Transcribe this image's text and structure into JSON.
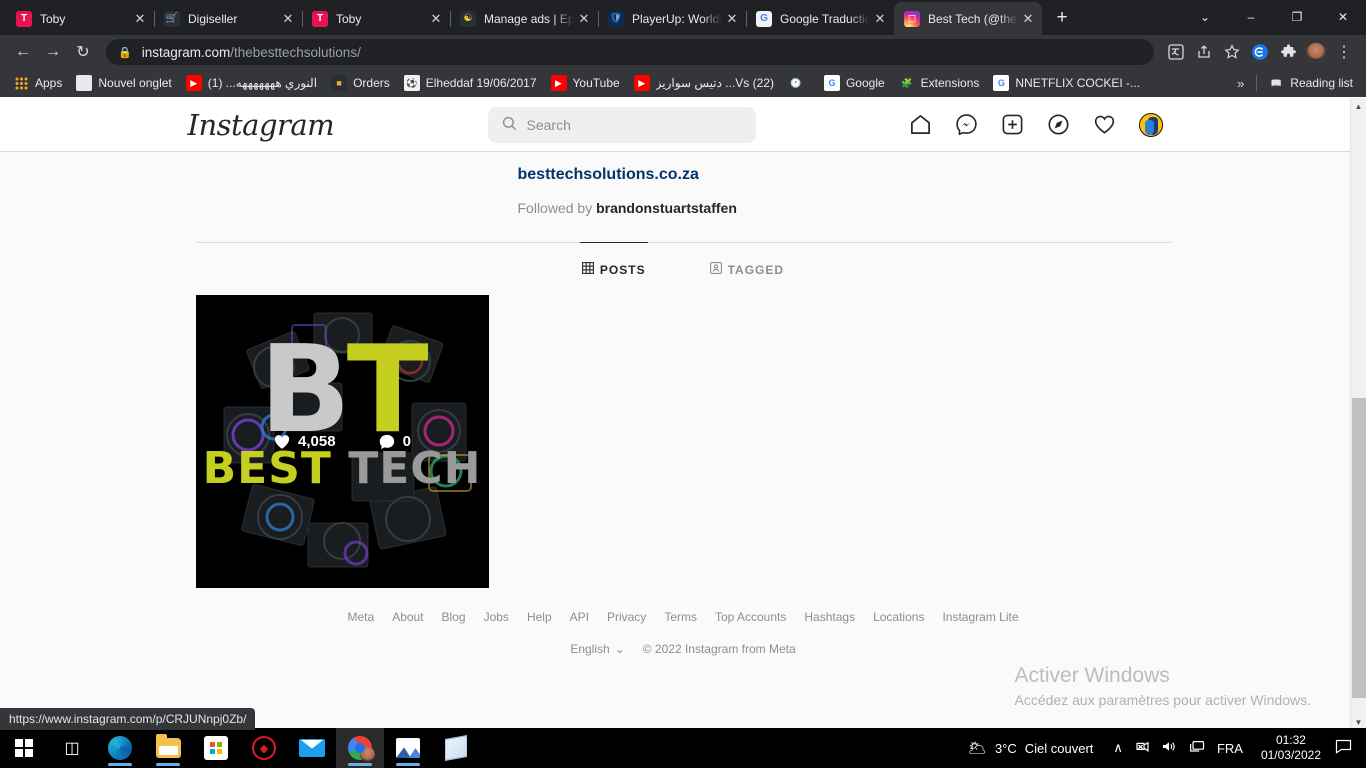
{
  "browser": {
    "tabs": [
      {
        "title": "Toby",
        "favicon": "toby-icon",
        "active": false
      },
      {
        "title": "Digiseller",
        "favicon": "digiseller-icon",
        "active": false
      },
      {
        "title": "Toby",
        "favicon": "toby-icon",
        "active": false
      },
      {
        "title": "Manage ads | Epi",
        "favicon": "epic-icon",
        "active": false
      },
      {
        "title": "PlayerUp: Worlds",
        "favicon": "playerup-icon",
        "active": false
      },
      {
        "title": "Google Traductio",
        "favicon": "google-translate-icon",
        "active": false
      },
      {
        "title": "Best Tech (@theb",
        "favicon": "instagram-icon",
        "active": true
      }
    ],
    "tab_close_label": "✕",
    "new_tab_label": "+",
    "window_controls": {
      "tab_search": "⌄",
      "minimize": "–",
      "maximize": "❐",
      "close": "✕"
    },
    "nav": {
      "back": "←",
      "forward": "→",
      "reload": "↻"
    },
    "omnibox": {
      "lock_icon": "🔒",
      "url_domain": "instagram.com",
      "url_path": "/thebesttechsolutions/"
    },
    "toolbar_icons": [
      {
        "name": "translate-icon",
        "glyph": "文"
      },
      {
        "name": "share-icon",
        "glyph": "↱"
      },
      {
        "name": "bookmark-star-icon",
        "glyph": "☆"
      },
      {
        "name": "extension-blue-icon",
        "glyph": "e"
      },
      {
        "name": "extensions-puzzle-icon",
        "glyph": "🧩"
      },
      {
        "name": "profile-avatar-icon",
        "glyph": ""
      },
      {
        "name": "more-menu-icon",
        "glyph": "⋮"
      }
    ],
    "bookmarks": [
      {
        "label": "Apps",
        "icon": "apps-grid-icon"
      },
      {
        "label": "Nouvel onglet",
        "icon": "blank-page-icon"
      },
      {
        "label": "النوري هههههههه... (1)",
        "icon": "youtube-icon"
      },
      {
        "label": "Orders",
        "icon": "orders-icon"
      },
      {
        "label": "Elheddaf 19/06/2017",
        "icon": "football-icon"
      },
      {
        "label": "YouTube",
        "icon": "youtube-icon"
      },
      {
        "label": "دتيس سواريز ...Vs (22)",
        "icon": "youtube-icon"
      },
      {
        "label": "",
        "icon": "history-clock-icon"
      },
      {
        "label": "Google",
        "icon": "google-icon"
      },
      {
        "label": "Extensions",
        "icon": "puzzle-icon"
      },
      {
        "label": "NNETFLIX COCKEI -...",
        "icon": "google-icon"
      }
    ],
    "bookmarks_overflow": "»",
    "reading_list": {
      "label": "Reading list",
      "icon": "reading-list-icon"
    },
    "status_url": "https://www.instagram.com/p/CRJUNnpj0Zb/"
  },
  "instagram": {
    "logo": "Instagram",
    "search": {
      "placeholder": "Search",
      "icon": "search-icon",
      "value": ""
    },
    "nav_icons": [
      {
        "name": "home-icon",
        "label": "Home"
      },
      {
        "name": "messenger-icon",
        "label": "Messages"
      },
      {
        "name": "new-post-icon",
        "label": "New post"
      },
      {
        "name": "explore-compass-icon",
        "label": "Explore"
      },
      {
        "name": "activity-heart-icon",
        "label": "Activity"
      },
      {
        "name": "profile-avatar",
        "label": "Profile"
      }
    ],
    "profile": {
      "website": "besttechsolutions.co.za",
      "followed_by_prefix": "Followed by",
      "followed_by_user": "brandonstuartstaffen"
    },
    "tabs": [
      {
        "label": "POSTS",
        "icon": "grid-icon",
        "active": true
      },
      {
        "label": "TAGGED",
        "icon": "tagged-person-icon",
        "active": false
      }
    ],
    "posts": [
      {
        "likes": "4,058",
        "comments": "0",
        "like_icon": "heart-filled-icon",
        "comment_icon": "comment-filled-icon",
        "art": {
          "letter_b": "B",
          "letter_t": "T",
          "word_1": "BEST",
          "word_2": "TECH",
          "color_b": "#c9c9c9",
          "color_t": "#c4cf1f",
          "background": "#000000"
        }
      }
    ],
    "footer": {
      "links": [
        "Meta",
        "About",
        "Blog",
        "Jobs",
        "Help",
        "API",
        "Privacy",
        "Terms",
        "Top Accounts",
        "Hashtags",
        "Locations",
        "Instagram Lite"
      ],
      "language": "English",
      "language_caret": "⌄",
      "copyright": "© 2022 Instagram from Meta"
    }
  },
  "watermark": {
    "title": "Activer Windows",
    "subtitle": "Accédez aux paramètres pour activer Windows."
  },
  "taskbar": {
    "items": [
      {
        "name": "start-button",
        "icon": "windows-logo-icon"
      },
      {
        "name": "task-view-button",
        "icon": "task-view-icon"
      },
      {
        "name": "edge-button",
        "icon": "edge-icon"
      },
      {
        "name": "file-explorer-button",
        "icon": "folder-icon"
      },
      {
        "name": "microsoft-store-button",
        "icon": "store-icon"
      },
      {
        "name": "ccleaner-button",
        "icon": "ccleaner-icon"
      },
      {
        "name": "mail-button",
        "icon": "mail-icon"
      },
      {
        "name": "chrome-button",
        "icon": "chrome-icon"
      },
      {
        "name": "photos-button",
        "icon": "photos-icon"
      },
      {
        "name": "notepad-button",
        "icon": "notepad-icon"
      }
    ],
    "weather": {
      "icon": "partly-cloudy-night-icon",
      "temp": "3°C",
      "condition": "Ciel couvert"
    },
    "tray": {
      "overflow": "∧",
      "network_icon": "🖧",
      "volume_icon": "🔊",
      "display_icon": "🖥",
      "language": "FRA"
    },
    "clock": {
      "time": "01:32",
      "date": "01/03/2022"
    },
    "notifications_icon": "💬"
  },
  "colors": {
    "chrome_bg": "#202124",
    "toolbar_bg": "#35363a",
    "ig_link": "#00376b",
    "ig_muted": "#8e8e8e",
    "accent_yellow": "#c4cf1f"
  }
}
